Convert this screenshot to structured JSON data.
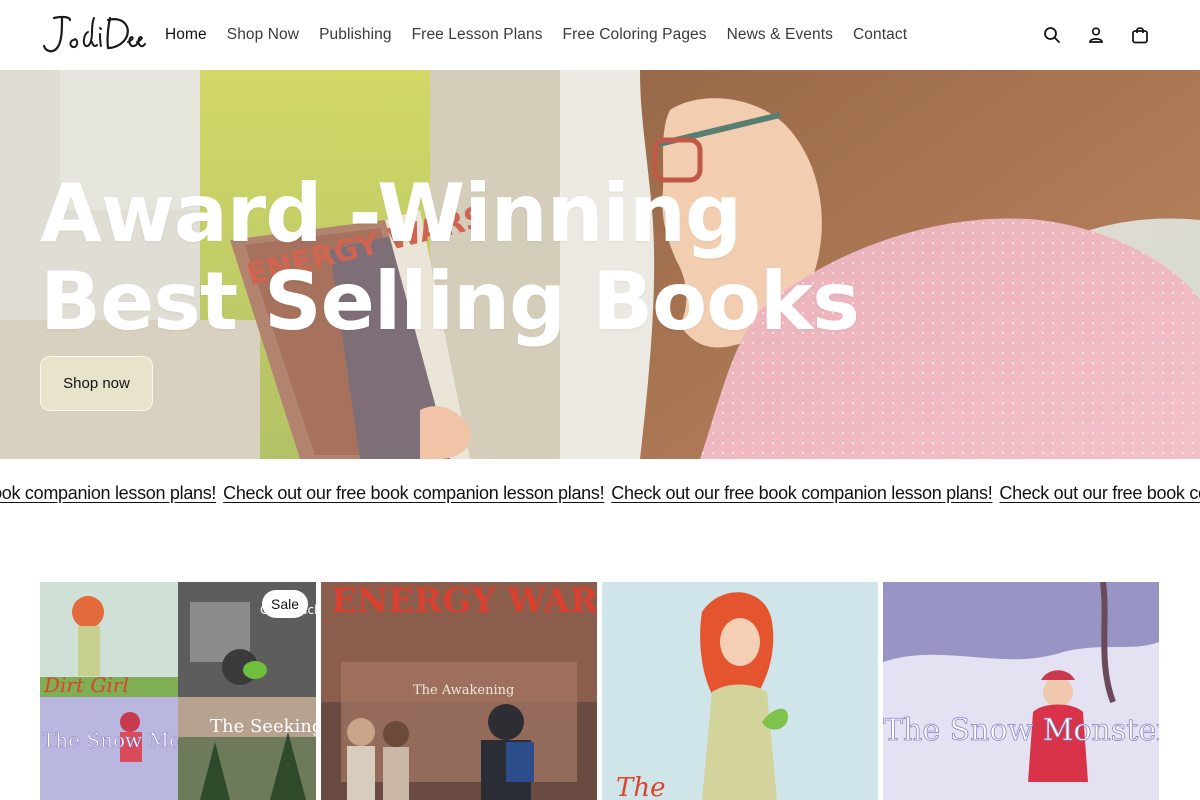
{
  "header": {
    "logo_text": "Jodi Dee",
    "nav": [
      {
        "label": "Home"
      },
      {
        "label": "Shop Now"
      },
      {
        "label": "Publishing"
      },
      {
        "label": "Free Lesson Plans"
      },
      {
        "label": "Free Coloring Pages"
      },
      {
        "label": "News & Events"
      },
      {
        "label": "Contact"
      }
    ],
    "icons": [
      "search-icon",
      "account-icon",
      "cart-icon"
    ]
  },
  "hero": {
    "title_line1": "Award -Winning",
    "title_line2": "Best Selling Books",
    "button_label": "Shop now",
    "book_title": "ENERGY WARS"
  },
  "marquee": {
    "text": "Check out our free book companion lesson plans!"
  },
  "products": [
    {
      "badge": "Sale",
      "cover_titles": [
        "Dirt Girl",
        "Grandjack",
        "The Snow Monster",
        "The Seeking Tree"
      ]
    },
    {
      "cover_title": "ENERGY WARS",
      "cover_subtitle": "The Awakening"
    },
    {
      "cover_title": "The"
    },
    {
      "cover_title": "The Snow Monster"
    }
  ],
  "colors": {
    "text": "#121212",
    "hero_text": "#ffffff",
    "button_bg": "#ebe4cd",
    "pink": "#f0b2bd"
  }
}
